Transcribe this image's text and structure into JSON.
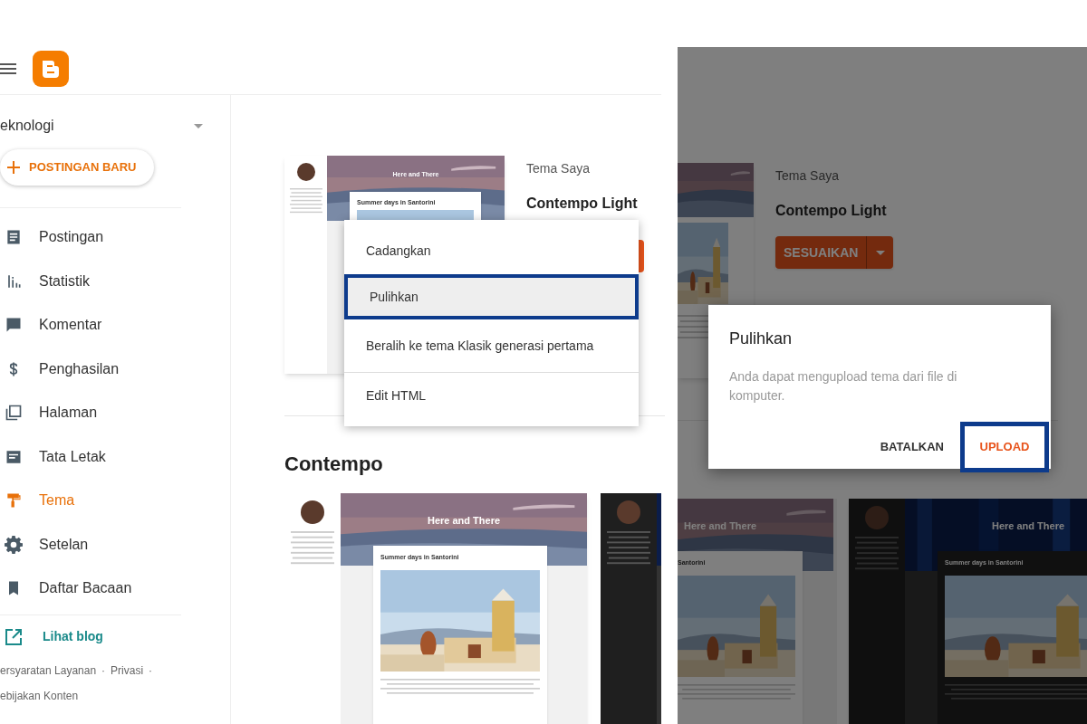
{
  "left": {
    "sidebar": {
      "blog_name": "eknologi",
      "new_post_button": "POSTINGAN BARU",
      "items": [
        {
          "label": "Postingan",
          "selected": false
        },
        {
          "label": "Statistik",
          "selected": false
        },
        {
          "label": "Komentar",
          "selected": false
        },
        {
          "label": "Penghasilan",
          "selected": false
        },
        {
          "label": "Halaman",
          "selected": false
        },
        {
          "label": "Tata Letak",
          "selected": false
        },
        {
          "label": "Tema",
          "selected": true
        },
        {
          "label": "Setelan",
          "selected": false
        },
        {
          "label": "Daftar Bacaan",
          "selected": false
        }
      ],
      "view_blog": "Lihat blog",
      "footer_links": [
        "ersyaratan Layanan",
        "Privasi",
        "ebijakan Konten"
      ],
      "separator": "·"
    },
    "my_theme": {
      "heading": "Tema Saya",
      "name": "Contempo Light",
      "thumbnail": {
        "blog_title": "Here and There",
        "post_title": "Summer days in Santorini"
      }
    },
    "menu": {
      "items": [
        {
          "label": "Cadangkan",
          "selected": false
        },
        {
          "label": "Pulihkan",
          "selected": true
        },
        {
          "label": "Beralih ke tema Klasik generasi pertama",
          "selected": false
        },
        {
          "label": "Edit HTML",
          "selected": false
        }
      ]
    },
    "section_title": "Contempo",
    "previews": [
      {
        "kind": "light",
        "blog_title": "Here and There",
        "post_title": "Summer days in Santorini"
      },
      {
        "kind": "dark"
      }
    ]
  },
  "right": {
    "my_theme": {
      "heading": "Tema Saya",
      "name": "Contempo Light",
      "customize_button": "SESUAIKAN"
    },
    "previews": [
      {
        "kind": "light",
        "blog_title": "Here and There",
        "post_title": "Santorini"
      },
      {
        "kind": "dark",
        "blog_title": "Here and There",
        "post_title": "Summer days in Santorini"
      }
    ],
    "dialog": {
      "title": "Pulihkan",
      "message": "Anda dapat mengupload tema dari file di komputer.",
      "buttons": [
        {
          "label": "BATALKAN",
          "outlined": false
        },
        {
          "label": "UPLOAD",
          "outlined": true
        }
      ]
    }
  }
}
